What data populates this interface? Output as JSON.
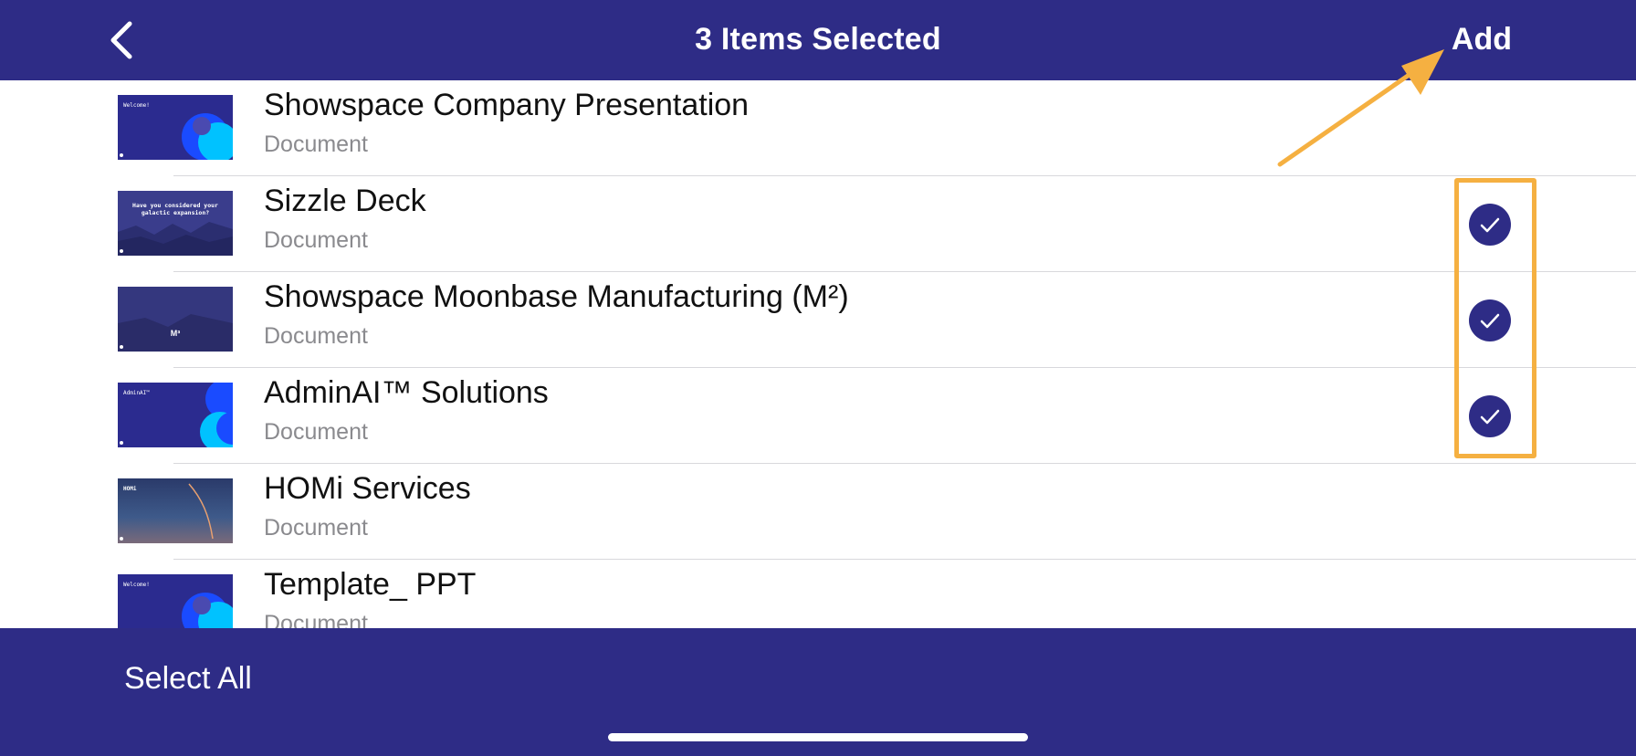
{
  "header": {
    "title": "3 Items Selected",
    "add_label": "Add",
    "back_icon": "chevron-left-icon"
  },
  "colors": {
    "brand": "#2e2c86",
    "highlight": "#f5b041",
    "subtitle": "#8a8a8e"
  },
  "items": [
    {
      "title": "Showspace Company Presentation",
      "subtitle": "Document",
      "selected": false,
      "thumbnail": "Welcome!"
    },
    {
      "title": "Sizzle Deck",
      "subtitle": "Document",
      "selected": true,
      "thumbnail": "Have you considered your galactic expansion?"
    },
    {
      "title": "Showspace Moonbase Manufacturing (M²)",
      "subtitle": "Document",
      "selected": true,
      "thumbnail": "M³"
    },
    {
      "title": "AdminAI™ Solutions",
      "subtitle": "Document",
      "selected": true,
      "thumbnail": "AdminAI™"
    },
    {
      "title": "HOMi Services",
      "subtitle": "Document",
      "selected": false,
      "thumbnail": "HOMi"
    },
    {
      "title": "Template_ PPT",
      "subtitle": "Document",
      "selected": false,
      "thumbnail": "Welcome!"
    }
  ],
  "footer": {
    "select_all_label": "Select All"
  }
}
